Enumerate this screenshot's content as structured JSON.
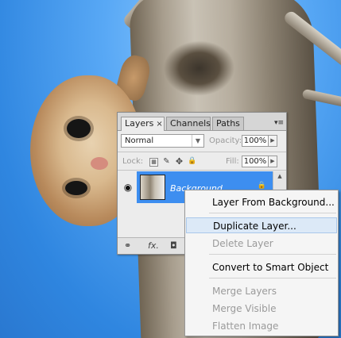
{
  "panel": {
    "tabs": [
      {
        "label": "Layers",
        "close": "×"
      },
      {
        "label": "Channels"
      },
      {
        "label": "Paths"
      }
    ],
    "menu_glyph": "▾≡",
    "blend_mode": "Normal",
    "opacity_label": "Opacity:",
    "opacity_value": "100%",
    "lock_label": "Lock:",
    "fill_label": "Fill:",
    "fill_value": "100%",
    "layer_name": "Background",
    "bottom_fx": "fx."
  },
  "menu": {
    "items": [
      {
        "label": "Layer From Background...",
        "enabled": true
      },
      {
        "label": "Duplicate Layer...",
        "enabled": true,
        "highlighted": true
      },
      {
        "label": "Delete Layer",
        "enabled": false
      },
      {
        "label": "Convert to Smart Object",
        "enabled": true
      },
      {
        "label": "Merge Layers",
        "enabled": false
      },
      {
        "label": "Merge Visible",
        "enabled": false
      },
      {
        "label": "Flatten Image",
        "enabled": false
      }
    ]
  },
  "colors": {
    "selection": "#3d8ef0",
    "menu_highlight": "#dce9f7",
    "disabled_text": "#9a9a9a"
  }
}
